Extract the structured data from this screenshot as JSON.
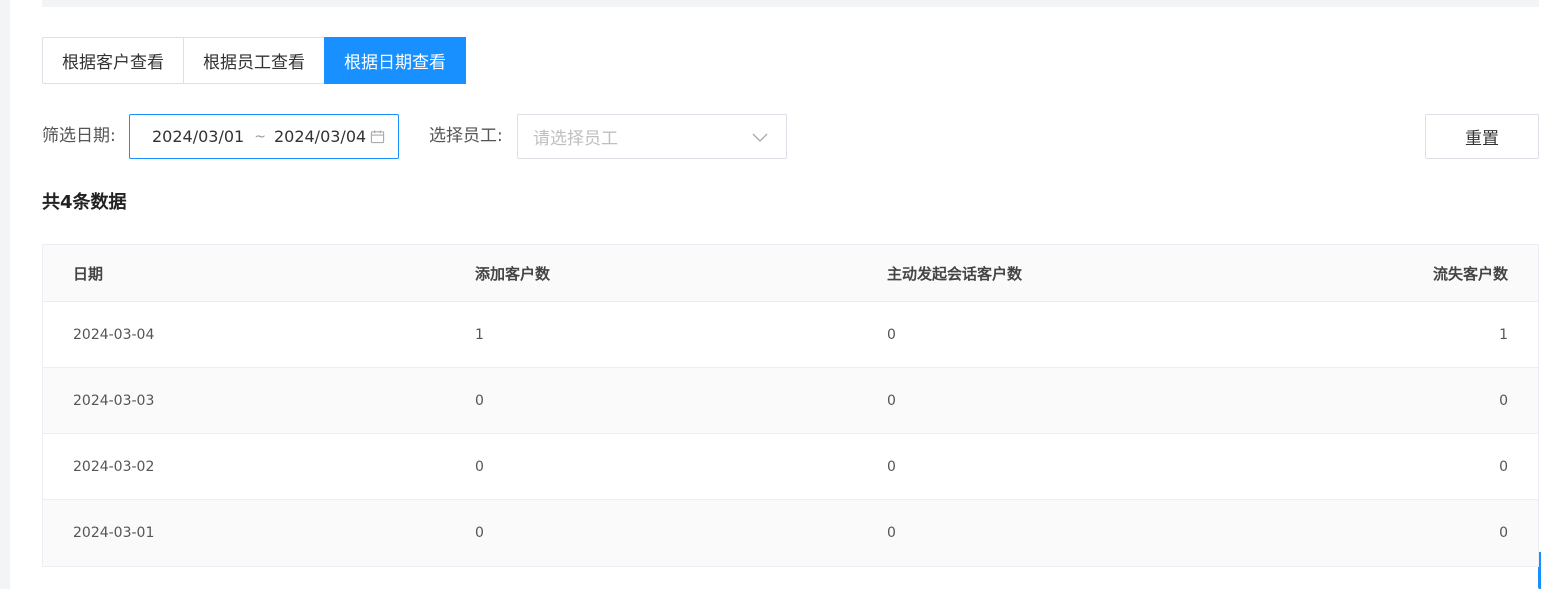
{
  "tabs": [
    {
      "label": "根据客户查看",
      "active": false
    },
    {
      "label": "根据员工查看",
      "active": false
    },
    {
      "label": "根据日期查看",
      "active": true
    }
  ],
  "filters": {
    "date_label": "筛选日期:",
    "date_start": "2024/03/01",
    "date_separator": "~",
    "date_end": "2024/03/04",
    "staff_label": "选择员工:",
    "staff_placeholder": "请选择员工",
    "reset_label": "重置"
  },
  "summary": {
    "total_text": "共4条数据"
  },
  "table": {
    "columns": [
      "日期",
      "添加客户数",
      "主动发起会话客户数",
      "流失客户数"
    ],
    "rows": [
      [
        "2024-03-04",
        "1",
        "0",
        "1"
      ],
      [
        "2024-03-03",
        "0",
        "0",
        "0"
      ],
      [
        "2024-03-02",
        "0",
        "0",
        "0"
      ],
      [
        "2024-03-01",
        "0",
        "0",
        "0"
      ]
    ]
  },
  "colors": {
    "accent": "#1890ff",
    "border": "#dcdfe6",
    "header_bg": "#fafafa"
  },
  "icons": {
    "date_picker": "calendar-icon",
    "select": "chevron-down-icon"
  }
}
